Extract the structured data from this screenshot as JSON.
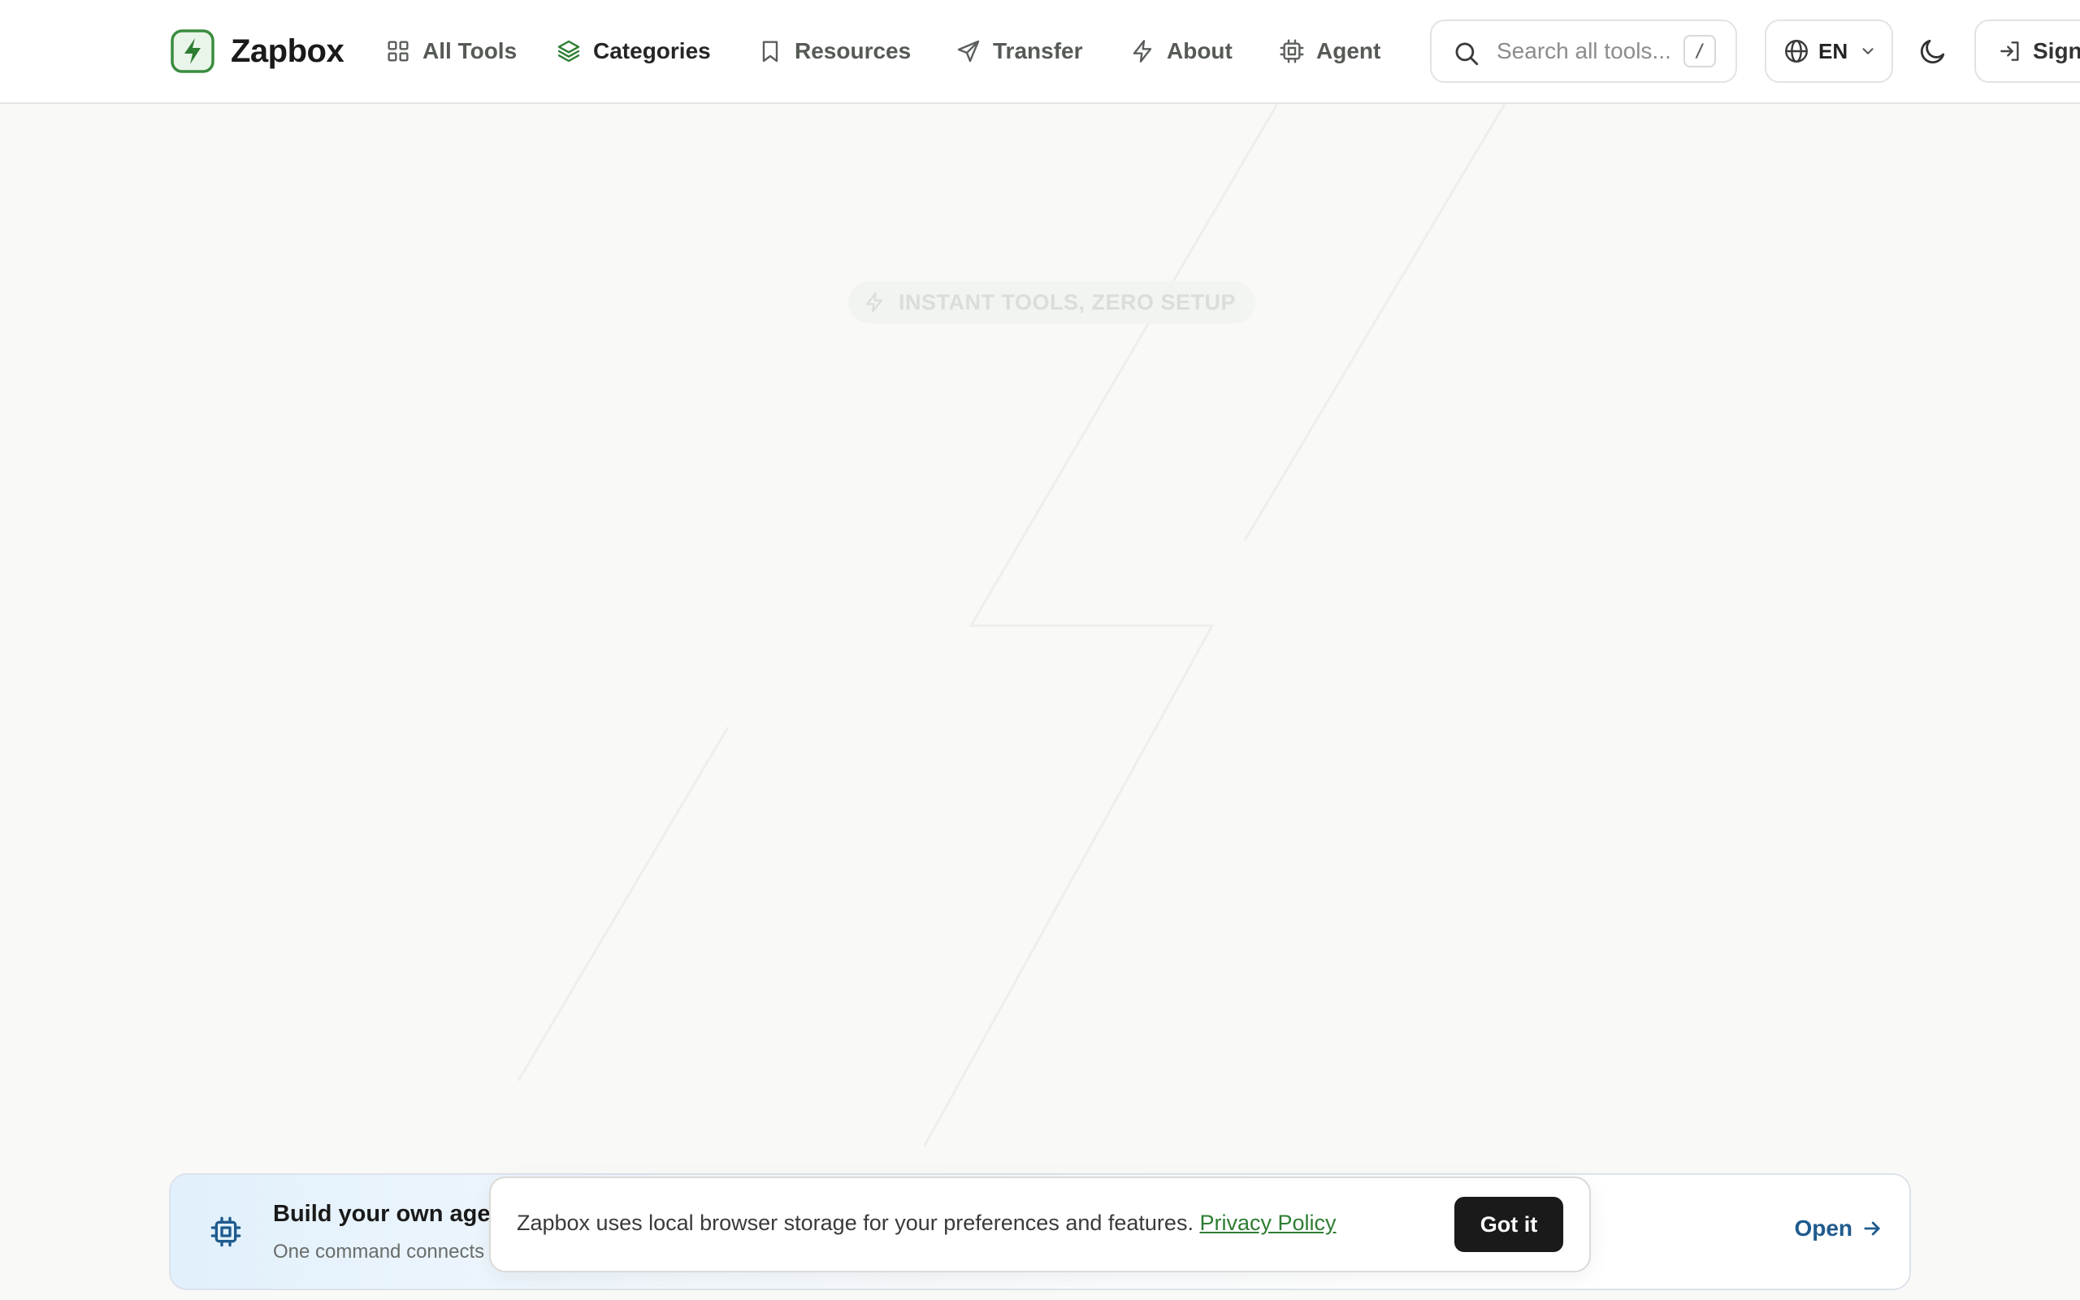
{
  "brand": {
    "name": "Zapbox",
    "accent_color": "#2e7d32"
  },
  "nav": {
    "items": [
      {
        "label": "All Tools",
        "icon": "grid-icon"
      },
      {
        "label": "Categories",
        "icon": "layers-icon",
        "active": true
      },
      {
        "label": "Resources",
        "icon": "bookmark-icon"
      },
      {
        "label": "Transfer",
        "icon": "send-icon"
      },
      {
        "label": "About",
        "icon": "zap-icon"
      },
      {
        "label": "Agent",
        "icon": "cpu-icon"
      }
    ]
  },
  "search": {
    "placeholder": "Search all tools...",
    "shortcut": "/"
  },
  "language": {
    "value": "EN"
  },
  "theme": {
    "icon": "moon-icon"
  },
  "auth": {
    "signin_label": "Sign"
  },
  "hero": {
    "badge": "INSTANT TOOLS, ZERO SETUP"
  },
  "agent_banner": {
    "title": "Build your own agen",
    "subtitle": "One command connects",
    "open_label": "Open"
  },
  "cookie": {
    "text": "Zapbox uses local browser storage for your preferences and features.",
    "link_label": "Privacy Policy",
    "button_label": "Got it"
  }
}
